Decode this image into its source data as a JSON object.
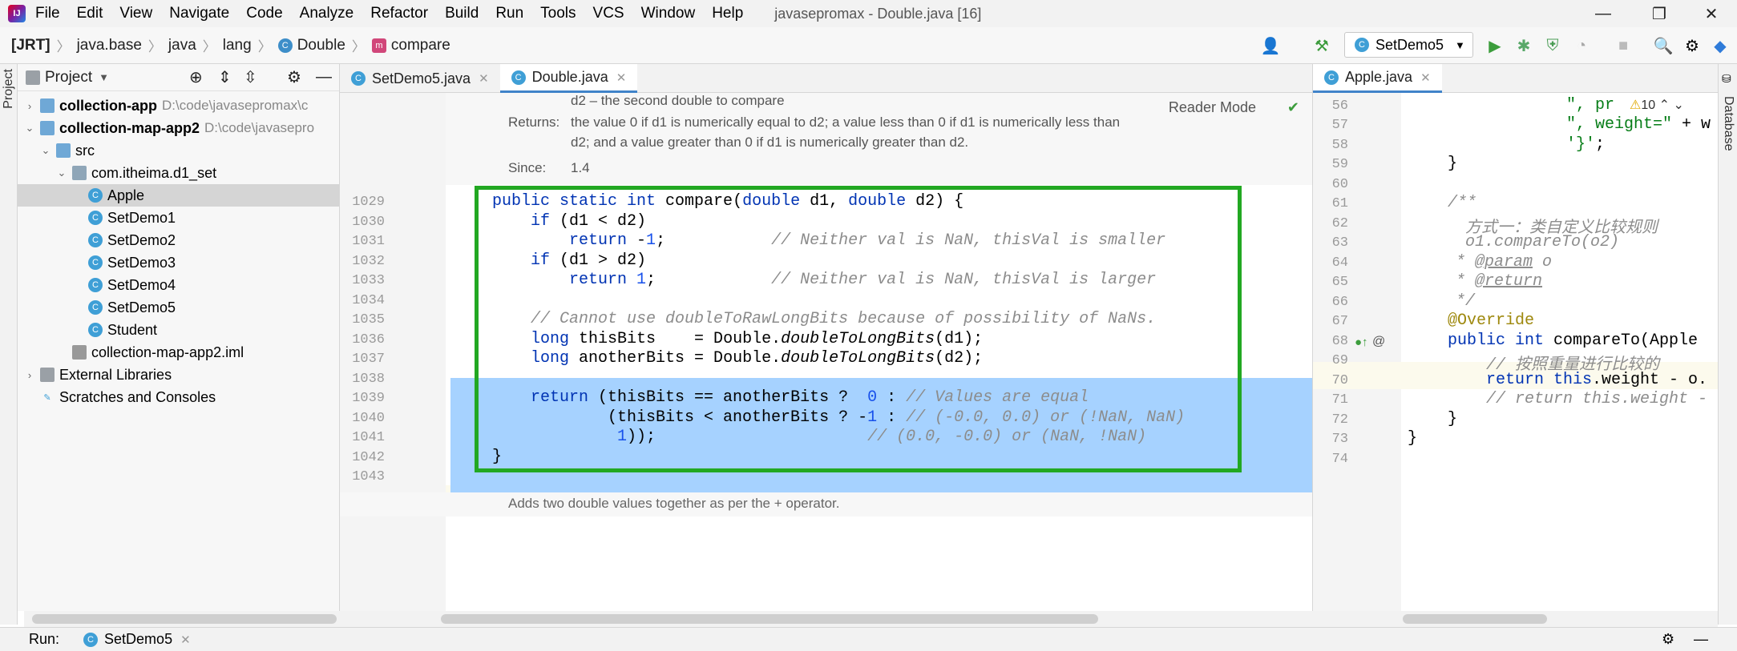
{
  "window": {
    "title": "javasepromax - Double.java [16]",
    "controls": [
      "—",
      "❐",
      "✕"
    ]
  },
  "menu": [
    "File",
    "Edit",
    "View",
    "Navigate",
    "Code",
    "Analyze",
    "Refactor",
    "Build",
    "Run",
    "Tools",
    "VCS",
    "Window",
    "Help"
  ],
  "breadcrumbs": [
    "[JRT]",
    "java.base",
    "java",
    "lang",
    "Double",
    "compare"
  ],
  "toolbar": {
    "run_config": "SetDemo5"
  },
  "project": {
    "title": "Project",
    "items": [
      {
        "label": "collection-app",
        "hint": "D:\\code\\javasepromax\\c",
        "kind": "module",
        "bold": true
      },
      {
        "label": "collection-map-app2",
        "hint": "D:\\code\\javasepro",
        "kind": "module",
        "bold": true
      },
      {
        "label": "src",
        "kind": "folder"
      },
      {
        "label": "com.itheima.d1_set",
        "kind": "package"
      },
      {
        "label": "Apple",
        "kind": "class"
      },
      {
        "label": "SetDemo1",
        "kind": "class"
      },
      {
        "label": "SetDemo2",
        "kind": "class"
      },
      {
        "label": "SetDemo3",
        "kind": "class"
      },
      {
        "label": "SetDemo4",
        "kind": "class"
      },
      {
        "label": "SetDemo5",
        "kind": "class"
      },
      {
        "label": "Student",
        "kind": "class"
      },
      {
        "label": "collection-map-app2.iml",
        "kind": "iml"
      },
      {
        "label": "External Libraries",
        "kind": "lib"
      },
      {
        "label": "Scratches and Consoles",
        "kind": "scratch"
      }
    ]
  },
  "tabs_left": [
    {
      "label": "SetDemo5.java"
    },
    {
      "label": "Double.java",
      "active": true
    }
  ],
  "tabs_right": [
    {
      "label": "Apple.java",
      "active": true
    }
  ],
  "editor": {
    "reader_mode": "Reader Mode",
    "doc": {
      "param_line": "d2 – the second double to compare",
      "returns_label": "Returns:",
      "returns_1": "the value 0 if d1 is numerically equal to d2; a value less than 0 if d1 is numerically less than",
      "returns_2": "d2; and a value greater than 0 if d1 is numerically greater than d2.",
      "since_label": "Since:",
      "since_value": "1.4",
      "footer": "Adds two double values together as per the + operator."
    },
    "line_numbers": [
      "1029",
      "1030",
      "1031",
      "1032",
      "1033",
      "1034",
      "1035",
      "1036",
      "1037",
      "1038",
      "1039",
      "1040",
      "1041",
      "1042",
      "1043"
    ]
  },
  "editor_right": {
    "line_numbers": [
      "56",
      "57",
      "58",
      "59",
      "60",
      "61",
      "62",
      "63",
      "64",
      "65",
      "66",
      "67",
      "68",
      "69",
      "70",
      "71",
      "72",
      "73",
      "74"
    ],
    "warnings": "10"
  },
  "bottom": {
    "run_label": "Run:",
    "run_tab": "SetDemo5"
  },
  "strips": {
    "left": "Project",
    "right": "Database"
  }
}
